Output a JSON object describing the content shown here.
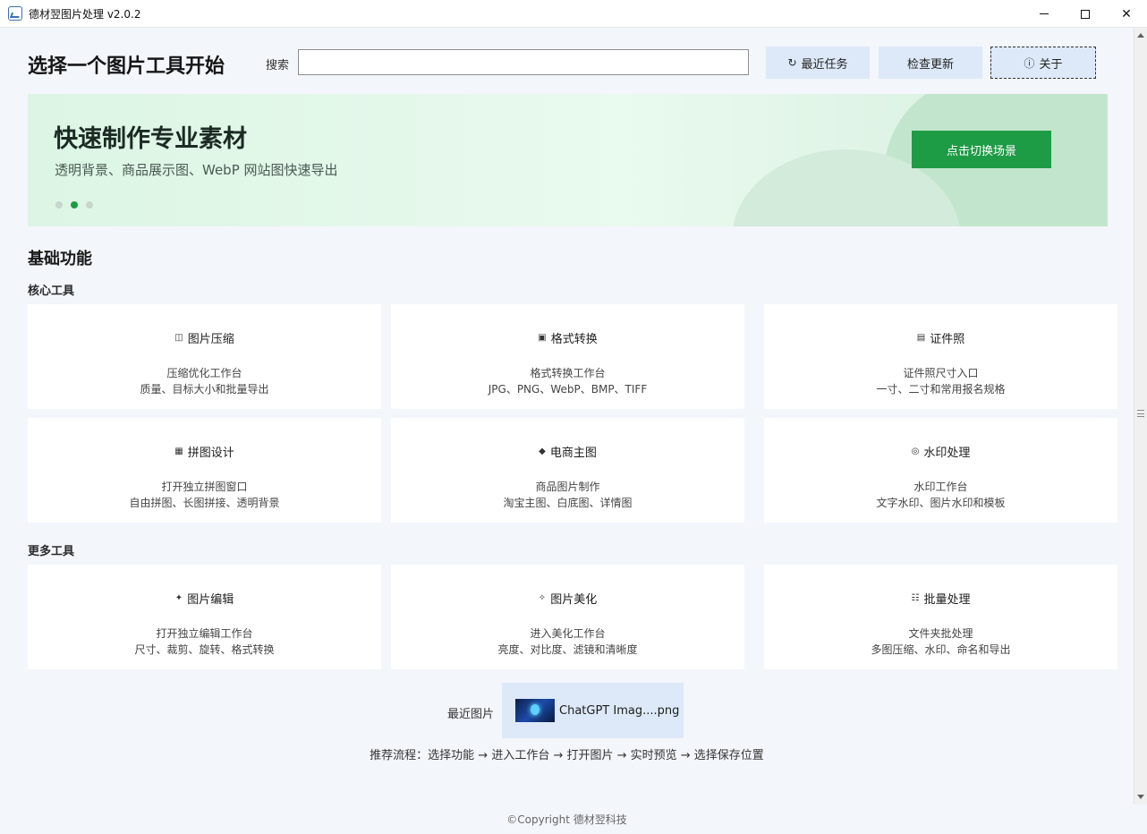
{
  "window": {
    "title": "德材翌图片处理 v2.0.2",
    "controls": {
      "minimize": "",
      "maximize": "",
      "close": "✕"
    }
  },
  "header": {
    "page_title": "选择一个图片工具开始",
    "search_label": "搜索",
    "search_value": "",
    "buttons": {
      "recent": {
        "icon": "↻",
        "label": "最近任务"
      },
      "update": {
        "label": "检查更新"
      },
      "about": {
        "icon": "ⓘ",
        "label": "关于"
      }
    }
  },
  "banner": {
    "title": "快速制作专业素材",
    "subtitle": "透明背景、商品展示图、WebP 网站图快速导出",
    "button": "点击切换场景",
    "active_slide": 2,
    "slide_count": 3,
    "colors": {
      "accent": "#1e9b45"
    }
  },
  "main": {
    "section_title": "基础功能",
    "groups": [
      {
        "title": "核心工具",
        "cards": [
          {
            "icon": "◫",
            "icon_name": "compress-icon",
            "title": "图片压缩",
            "line1": "压缩优化工作台",
            "line2": "质量、目标大小和批量导出"
          },
          {
            "icon": "▣",
            "icon_name": "format-icon",
            "title": "格式转换",
            "line1": "格式转换工作台",
            "line2": "JPG、PNG、WebP、BMP、TIFF"
          },
          {
            "icon": "▤",
            "icon_name": "id-photo-icon",
            "title": "证件照",
            "line1": "证件照尺寸入口",
            "line2": "一寸、二寸和常用报名规格"
          },
          {
            "icon": "▦",
            "icon_name": "collage-icon",
            "title": "拼图设计",
            "line1": "打开独立拼图窗口",
            "line2": "自由拼图、长图拼接、透明背景"
          },
          {
            "icon": "◆",
            "icon_name": "ecommerce-icon",
            "title": "电商主图",
            "line1": "商品图片制作",
            "line2": "淘宝主图、白底图、详情图"
          },
          {
            "icon": "◎",
            "icon_name": "watermark-icon",
            "title": "水印处理",
            "line1": "水印工作台",
            "line2": "文字水印、图片水印和模板"
          }
        ]
      },
      {
        "title": "更多工具",
        "cards": [
          {
            "icon": "✦",
            "icon_name": "edit-icon",
            "title": "图片编辑",
            "line1": "打开独立编辑工作台",
            "line2": "尺寸、裁剪、旋转、格式转换"
          },
          {
            "icon": "✧",
            "icon_name": "beautify-icon",
            "title": "图片美化",
            "line1": "进入美化工作台",
            "line2": "亮度、对比度、滤镜和清晰度"
          },
          {
            "icon": "☷",
            "icon_name": "batch-icon",
            "title": "批量处理",
            "line1": "文件夹批处理",
            "line2": "多图压缩、水印、命名和导出"
          }
        ]
      }
    ]
  },
  "recent": {
    "label": "最近图片",
    "file": "ChatGPT Imag....png"
  },
  "flow_text": "推荐流程：选择功能 → 进入工作台 → 打开图片 → 实时预览 → 选择保存位置",
  "footer": {
    "copyright": "©Copyright 德材翌科技"
  }
}
